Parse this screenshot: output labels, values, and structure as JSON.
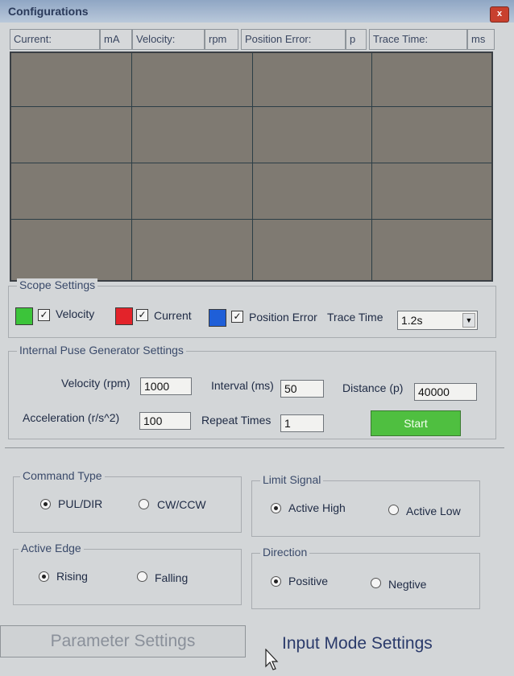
{
  "window": {
    "title": "Configurations",
    "close_label": "x"
  },
  "readouts": {
    "current_label": "Current:",
    "current_unit": "mA",
    "velocity_label": "Velocity:",
    "velocity_unit": "rpm",
    "position_error_label": "Position Error:",
    "position_error_unit": "p",
    "trace_time_label": "Trace Time:",
    "trace_time_unit": "ms"
  },
  "scope_settings": {
    "legend": "Scope Settings",
    "velocity": {
      "label": "Velocity",
      "color": "#3cc43a",
      "checked": true
    },
    "current": {
      "label": "Current",
      "color": "#e3232a",
      "checked": true
    },
    "position_error": {
      "label": "Position Error",
      "color": "#1f5fd8",
      "checked": true
    },
    "trace_time_label": "Trace Time",
    "trace_time_value": "1.2s"
  },
  "pulse_generator": {
    "legend": "Internal Puse Generator Settings",
    "velocity_label": "Velocity (rpm)",
    "velocity_value": "1000",
    "interval_label": "Interval (ms)",
    "interval_value": "50",
    "distance_label": "Distance (p)",
    "distance_value": "40000",
    "acceleration_label": "Acceleration  (r/s^2)",
    "acceleration_value": "100",
    "repeat_label": "Repeat Times",
    "repeat_value": "1",
    "start_label": "Start"
  },
  "command_type": {
    "legend": "Command Type",
    "option1": "PUL/DIR",
    "option2": "CW/CCW",
    "selected": "PUL/DIR"
  },
  "limit_signal": {
    "legend": "Limit Signal",
    "option1": "Active High",
    "option2": "Active Low",
    "selected": "Active High"
  },
  "active_edge": {
    "legend": "Active Edge",
    "option1": "Rising",
    "option2": "Falling",
    "selected": "Rising"
  },
  "direction": {
    "legend": "Direction",
    "option1": "Positive",
    "option2": "Negtive",
    "selected": "Positive"
  },
  "tabs": {
    "parameter_settings": "Parameter Settings",
    "input_mode_settings": "Input Mode Settings"
  },
  "colors": {
    "start_button": "#4fbf40",
    "scope_background": "#7f7a72"
  }
}
